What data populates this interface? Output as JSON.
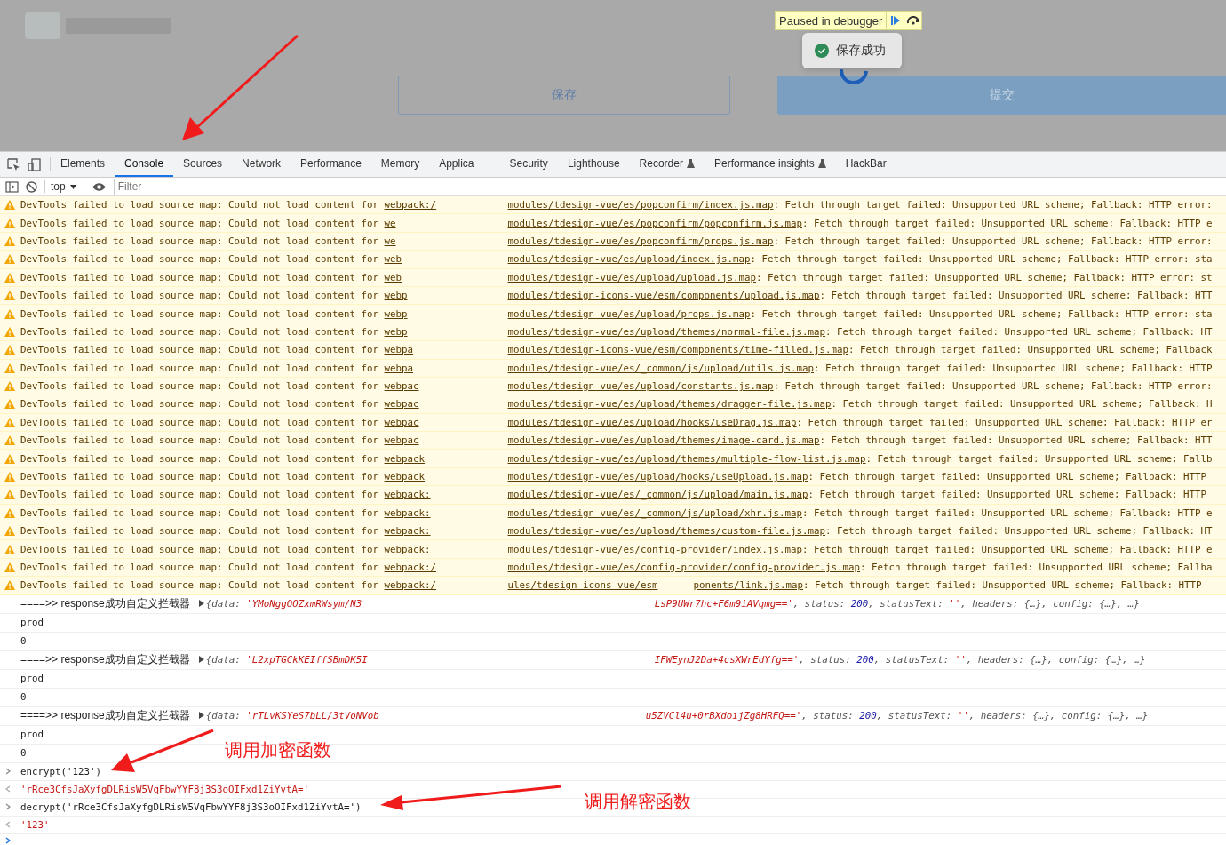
{
  "page": {
    "debugger": {
      "label": "Paused in debugger"
    },
    "toast": "保存成功",
    "buttons": [
      {
        "label": "保存",
        "kind": "outline"
      },
      {
        "label": "提交",
        "kind": "primary"
      }
    ]
  },
  "devtools": {
    "tabs": [
      {
        "label": "Elements",
        "selected": false
      },
      {
        "label": "Console",
        "selected": true
      },
      {
        "label": "Sources",
        "selected": false
      },
      {
        "label": "Network",
        "selected": false
      },
      {
        "label": "Performance",
        "selected": false
      },
      {
        "label": "Memory",
        "selected": false
      },
      {
        "label": "Applica",
        "selected": false
      },
      {
        "label": "Security",
        "selected": false
      },
      {
        "label": "Lighthouse",
        "selected": false
      },
      {
        "label": "Recorder",
        "selected": false,
        "experimental": true
      },
      {
        "label": "Performance insights",
        "selected": false,
        "experimental": true
      },
      {
        "label": "HackBar",
        "selected": false
      }
    ],
    "context": "top",
    "filter": {
      "placeholder": "Filter"
    },
    "warnings": [
      {
        "message": "DevTools failed to load source map: Could not load content for ",
        "link_start": "webpack:/",
        "link": "modules/tdesign-vue/es/popconfirm/index.js.map",
        "detail": ": Fetch through target failed: Unsupported URL scheme; Fallback: HTTP error:"
      },
      {
        "message": "DevTools failed to load source map: Could not load content for ",
        "link_start": "we",
        "link": "modules/tdesign-vue/es/popconfirm/popconfirm.js.map",
        "detail": ": Fetch through target failed: Unsupported URL scheme; Fallback: HTTP e"
      },
      {
        "message": "DevTools failed to load source map: Could not load content for ",
        "link_start": "we",
        "link": "modules/tdesign-vue/es/popconfirm/props.js.map",
        "detail": ": Fetch through target failed: Unsupported URL scheme; Fallback: HTTP error:"
      },
      {
        "message": "DevTools failed to load source map: Could not load content for ",
        "link_start": "web",
        "link": "modules/tdesign-vue/es/upload/index.js.map",
        "detail": ": Fetch through target failed: Unsupported URL scheme; Fallback: HTTP error: sta"
      },
      {
        "message": "DevTools failed to load source map: Could not load content for ",
        "link_start": "web",
        "link": "modules/tdesign-vue/es/upload/upload.js.map",
        "detail": ": Fetch through target failed: Unsupported URL scheme; Fallback: HTTP error: st"
      },
      {
        "message": "DevTools failed to load source map: Could not load content for ",
        "link_start": "webp",
        "link": "modules/tdesign-icons-vue/esm/components/upload.js.map",
        "detail": ": Fetch through target failed: Unsupported URL scheme; Fallback: HTT"
      },
      {
        "message": "DevTools failed to load source map: Could not load content for ",
        "link_start": "webp",
        "link": "modules/tdesign-vue/es/upload/props.js.map",
        "detail": ": Fetch through target failed: Unsupported URL scheme; Fallback: HTTP error: sta"
      },
      {
        "message": "DevTools failed to load source map: Could not load content for ",
        "link_start": "webp",
        "link": "modules/tdesign-vue/es/upload/themes/normal-file.js.map",
        "detail": ": Fetch through target failed: Unsupported URL scheme; Fallback: HT"
      },
      {
        "message": "DevTools failed to load source map: Could not load content for ",
        "link_start": "webpa",
        "link": "modules/tdesign-icons-vue/esm/components/time-filled.js.map",
        "detail": ": Fetch through target failed: Unsupported URL scheme; Fallback"
      },
      {
        "message": "DevTools failed to load source map: Could not load content for ",
        "link_start": "webpa",
        "link": "modules/tdesign-vue/es/_common/js/upload/utils.js.map",
        "detail": ": Fetch through target failed: Unsupported URL scheme; Fallback: HTTP"
      },
      {
        "message": "DevTools failed to load source map: Could not load content for ",
        "link_start": "webpac",
        "link": "modules/tdesign-vue/es/upload/constants.js.map",
        "detail": ": Fetch through target failed: Unsupported URL scheme; Fallback: HTTP error:"
      },
      {
        "message": "DevTools failed to load source map: Could not load content for ",
        "link_start": "webpac",
        "link": "modules/tdesign-vue/es/upload/themes/dragger-file.js.map",
        "detail": ": Fetch through target failed: Unsupported URL scheme; Fallback: H"
      },
      {
        "message": "DevTools failed to load source map: Could not load content for ",
        "link_start": "webpac",
        "link": "modules/tdesign-vue/es/upload/hooks/useDrag.js.map",
        "detail": ": Fetch through target failed: Unsupported URL scheme; Fallback: HTTP er"
      },
      {
        "message": "DevTools failed to load source map: Could not load content for ",
        "link_start": "webpac",
        "link": "modules/tdesign-vue/es/upload/themes/image-card.js.map",
        "detail": ": Fetch through target failed: Unsupported URL scheme; Fallback: HTT"
      },
      {
        "message": "DevTools failed to load source map: Could not load content for ",
        "link_start": "webpack",
        "link": "modules/tdesign-vue/es/upload/themes/multiple-flow-list.js.map",
        "detail": ": Fetch through target failed: Unsupported URL scheme; Fallb"
      },
      {
        "message": "DevTools failed to load source map: Could not load content for ",
        "link_start": "webpack",
        "link": "modules/tdesign-vue/es/upload/hooks/useUpload.js.map",
        "detail": ": Fetch through target failed: Unsupported URL scheme; Fallback: HTTP"
      },
      {
        "message": "DevTools failed to load source map: Could not load content for ",
        "link_start": "webpack:",
        "link": "modules/tdesign-vue/es/_common/js/upload/main.js.map",
        "detail": ": Fetch through target failed: Unsupported URL scheme; Fallback: HTTP"
      },
      {
        "message": "DevTools failed to load source map: Could not load content for ",
        "link_start": "webpack:",
        "link": "modules/tdesign-vue/es/_common/js/upload/xhr.js.map",
        "detail": ": Fetch through target failed: Unsupported URL scheme; Fallback: HTTP e"
      },
      {
        "message": "DevTools failed to load source map: Could not load content for ",
        "link_start": "webpack:",
        "link": "modules/tdesign-vue/es/upload/themes/custom-file.js.map",
        "detail": ": Fetch through target failed: Unsupported URL scheme; Fallback: HT"
      },
      {
        "message": "DevTools failed to load source map: Could not load content for ",
        "link_start": "webpack:",
        "link": "modules/tdesign-vue/es/config-provider/index.js.map",
        "detail": ": Fetch through target failed: Unsupported URL scheme; Fallback: HTTP e"
      },
      {
        "message": "DevTools failed to load source map: Could not load content for ",
        "link_start": "webpack:/",
        "link": "modules/tdesign-vue/es/config-provider/config-provider.js.map",
        "detail": ": Fetch through target failed: Unsupported URL scheme; Fallba"
      },
      {
        "message": "DevTools failed to load source map: Could not load content for ",
        "link_start": "webpack:/",
        "link": "ules/tdesign-icons-vue/esm",
        "link_end": "ponents/link.js.map",
        "detail": ": Fetch through target failed: Unsupported URL scheme; Fallback: HTTP"
      }
    ],
    "entries": [
      {
        "kind": "response",
        "label": "====>> response成功自定义拦截器",
        "key": "{data:",
        "data_start": "'YMoNggOOZxmRWsym/N3",
        "data_end": "LsP9UWr7hc+F6m9iAVqmg=='",
        "tail": [
          {
            "kind": "key",
            "text": ", status: "
          },
          {
            "kind": "number",
            "text": "200"
          },
          {
            "kind": "key",
            "text": ", statusText: "
          },
          {
            "kind": "string",
            "text": "''"
          },
          {
            "kind": "key",
            "text": ", headers: {…}, config: {…}, …}"
          }
        ]
      },
      {
        "kind": "text",
        "text": "prod"
      },
      {
        "kind": "text",
        "text": "0"
      },
      {
        "kind": "response",
        "label": "====>> response成功自定义拦截器",
        "key": "{data:",
        "data_start": "'L2xpTGCkKEIffSBmDK5I",
        "data_end": "IFWEynJ2Da+4csXWrEdYfg=='",
        "tail": [
          {
            "kind": "key",
            "text": ", status: "
          },
          {
            "kind": "number",
            "text": "200"
          },
          {
            "kind": "key",
            "text": ", statusText: "
          },
          {
            "kind": "string",
            "text": "''"
          },
          {
            "kind": "key",
            "text": ", headers: {…}, config: {…}, …}"
          }
        ]
      },
      {
        "kind": "text",
        "text": "prod"
      },
      {
        "kind": "text",
        "text": "0"
      },
      {
        "kind": "response",
        "label": "====>> response成功自定义拦截器",
        "key": "{data:",
        "data_start": "'rTLvKSYeS7bLL/3tVoNVob",
        "data_end": "u5ZVCl4u+0rBXdoijZg8HRFQ=='",
        "tail": [
          {
            "kind": "key",
            "text": ", status: "
          },
          {
            "kind": "number",
            "text": "200"
          },
          {
            "kind": "key",
            "text": ", statusText: "
          },
          {
            "kind": "string",
            "text": "''"
          },
          {
            "kind": "key",
            "text": ", headers: {…}, config: {…}, …}"
          }
        ]
      },
      {
        "kind": "text",
        "text": "prod"
      },
      {
        "kind": "text",
        "text": "0"
      },
      {
        "kind": "input",
        "text": "encrypt('123')"
      },
      {
        "kind": "result",
        "text": "'rRce3CfsJaXyfgDLRisW5VqFbwYYF8j3S3oOIFxd1ZiYvtA='"
      },
      {
        "kind": "input",
        "text": "decrypt('rRce3CfsJaXyfgDLRisW5VqFbwYYF8j3S3oOIFxd1ZiYvtA=')"
      },
      {
        "kind": "result",
        "text": "'123'"
      },
      {
        "kind": "prompt"
      }
    ]
  },
  "annotations": [
    "调用加密函数",
    "调用解密函数"
  ]
}
